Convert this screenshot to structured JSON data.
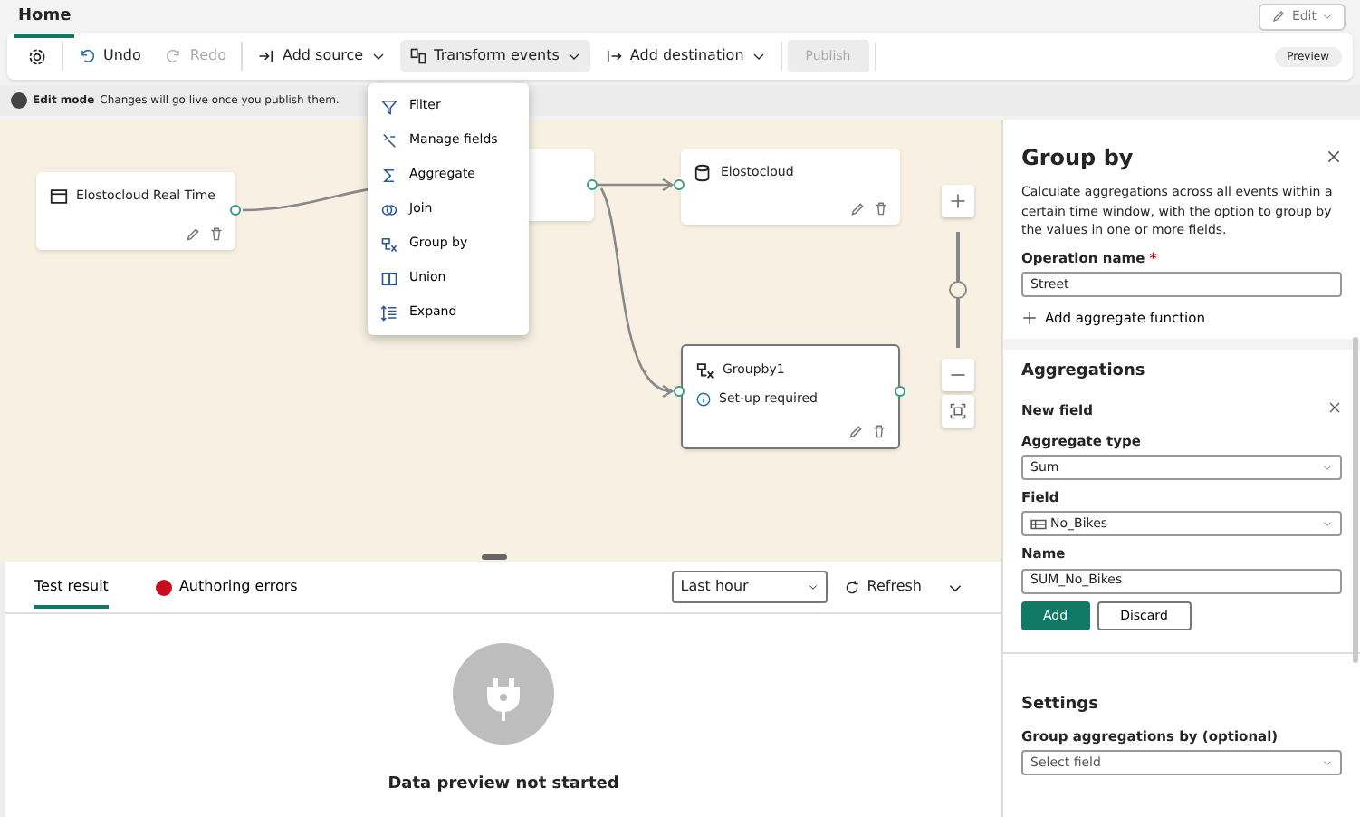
{
  "tabs": [
    {
      "label": "Home",
      "selected": true
    }
  ],
  "edit_button": {
    "label": "Edit"
  },
  "toolbar": [
    {
      "kind": "settings"
    },
    {
      "kind": "button",
      "label": "Undo",
      "disabled": false
    },
    {
      "kind": "button",
      "label": "Redo",
      "disabled": true
    },
    {
      "kind": "menu",
      "label": "Add source",
      "expanded": false
    },
    {
      "kind": "menu",
      "label": "Transform events",
      "expanded": true
    },
    {
      "kind": "menu",
      "label": "Add destination",
      "expanded": false
    },
    {
      "kind": "publish",
      "label": "Publish",
      "disabled": true
    }
  ],
  "preview_badge": "Preview",
  "info_bar": {
    "label": "Edit mode",
    "message": "Changes will go live once you publish them."
  },
  "transform_menu": [
    {
      "label": "Filter"
    },
    {
      "label": "Manage fields"
    },
    {
      "label": "Aggregate"
    },
    {
      "label": "Join"
    },
    {
      "label": "Group by"
    },
    {
      "label": "Union"
    },
    {
      "label": "Expand"
    }
  ],
  "canvas": {
    "nodes": [
      {
        "kind": "source",
        "title": "Elostocloud Real Time",
        "selected": false
      },
      {
        "kind": "hidden",
        "selected": false
      },
      {
        "kind": "destination",
        "title": "Elostocloud",
        "selected": false
      },
      {
        "kind": "operation",
        "title": "Groupby1",
        "status": "Set-up required",
        "selected": true
      }
    ],
    "zoom": {
      "level": 0.5
    }
  },
  "bottom_panel": {
    "tabs": [
      {
        "label": "Test result",
        "selected": true,
        "kind": "plain"
      },
      {
        "label": "Authoring errors",
        "selected": false,
        "kind": "error"
      }
    ],
    "time_range": "Last hour",
    "refresh": "Refresh",
    "empty_title": "Data preview not started"
  },
  "side_panel": {
    "title": "Group by",
    "description": "Calculate aggregations across all events within a certain time window, with the option to group by the values in one or more fields.",
    "operation_label": "Operation name",
    "required_mark": "*",
    "operation_value": "Street",
    "add_function": "Add aggregate function",
    "aggregations": {
      "title": "Aggregations",
      "subtitle": "New field",
      "type_label": "Aggregate type",
      "type_value": "Sum",
      "field_label": "Field",
      "field_value": "No_Bikes",
      "name_label": "Name",
      "name_value": "SUM_No_Bikes",
      "add": "Add",
      "discard": "Discard"
    },
    "settings": {
      "title": "Settings",
      "group_label": "Group aggregations by (optional)",
      "group_placeholder": "Select field"
    }
  }
}
